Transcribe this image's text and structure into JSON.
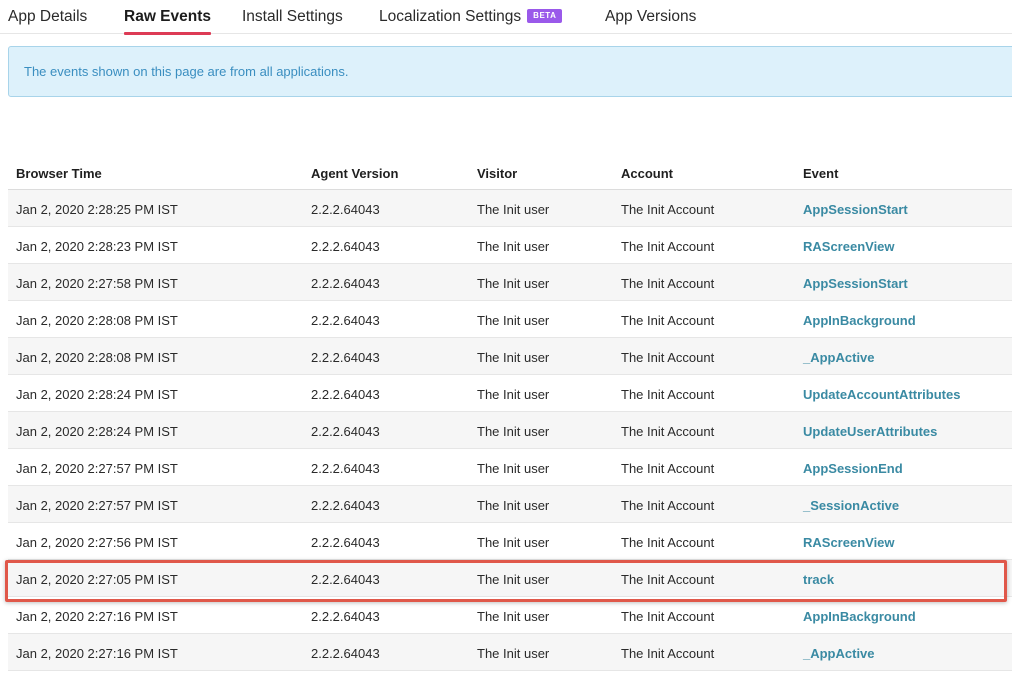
{
  "tabs": [
    {
      "label": "App Details",
      "active": false
    },
    {
      "label": "Raw Events",
      "active": true
    },
    {
      "label": "Install Settings",
      "active": false
    },
    {
      "label": "Localization Settings",
      "active": false,
      "badge": "BETA"
    },
    {
      "label": "App Versions",
      "active": false
    }
  ],
  "banner": {
    "text": "The events shown on this page are from all applications."
  },
  "table": {
    "headers": [
      "Browser Time",
      "Agent Version",
      "Visitor",
      "Account",
      "Event"
    ],
    "rows": [
      {
        "time": "Jan 2, 2020 2:28:25 PM IST",
        "agent": "2.2.2.64043",
        "visitor": "The Init user",
        "account": "The Init Account",
        "event": "AppSessionStart"
      },
      {
        "time": "Jan 2, 2020 2:28:23 PM IST",
        "agent": "2.2.2.64043",
        "visitor": "The Init user",
        "account": "The Init Account",
        "event": "RAScreenView"
      },
      {
        "time": "Jan 2, 2020 2:27:58 PM IST",
        "agent": "2.2.2.64043",
        "visitor": "The Init user",
        "account": "The Init Account",
        "event": "AppSessionStart"
      },
      {
        "time": "Jan 2, 2020 2:28:08 PM IST",
        "agent": "2.2.2.64043",
        "visitor": "The Init user",
        "account": "The Init Account",
        "event": "AppInBackground"
      },
      {
        "time": "Jan 2, 2020 2:28:08 PM IST",
        "agent": "2.2.2.64043",
        "visitor": "The Init user",
        "account": "The Init Account",
        "event": "_AppActive"
      },
      {
        "time": "Jan 2, 2020 2:28:24 PM IST",
        "agent": "2.2.2.64043",
        "visitor": "The Init user",
        "account": "The Init Account",
        "event": "UpdateAccountAttributes"
      },
      {
        "time": "Jan 2, 2020 2:28:24 PM IST",
        "agent": "2.2.2.64043",
        "visitor": "The Init user",
        "account": "The Init Account",
        "event": "UpdateUserAttributes"
      },
      {
        "time": "Jan 2, 2020 2:27:57 PM IST",
        "agent": "2.2.2.64043",
        "visitor": "The Init user",
        "account": "The Init Account",
        "event": "AppSessionEnd"
      },
      {
        "time": "Jan 2, 2020 2:27:57 PM IST",
        "agent": "2.2.2.64043",
        "visitor": "The Init user",
        "account": "The Init Account",
        "event": "_SessionActive"
      },
      {
        "time": "Jan 2, 2020 2:27:56 PM IST",
        "agent": "2.2.2.64043",
        "visitor": "The Init user",
        "account": "The Init Account",
        "event": "RAScreenView"
      },
      {
        "time": "Jan 2, 2020 2:27:05 PM IST",
        "agent": "2.2.2.64043",
        "visitor": "The Init user",
        "account": "The Init Account",
        "event": "track",
        "highlighted": true
      },
      {
        "time": "Jan 2, 2020 2:27:16 PM IST",
        "agent": "2.2.2.64043",
        "visitor": "The Init user",
        "account": "The Init Account",
        "event": "AppInBackground"
      },
      {
        "time": "Jan 2, 2020 2:27:16 PM IST",
        "agent": "2.2.2.64043",
        "visitor": "The Init user",
        "account": "The Init Account",
        "event": "_AppActive"
      }
    ]
  },
  "colors": {
    "tab_underline": "#dd3b55",
    "beta_badge": "#9a59ea",
    "banner_bg": "#ddf1fb",
    "banner_text": "#3a8ec0",
    "event_link": "#3a8aa3",
    "highlight_border": "#e0584a"
  }
}
